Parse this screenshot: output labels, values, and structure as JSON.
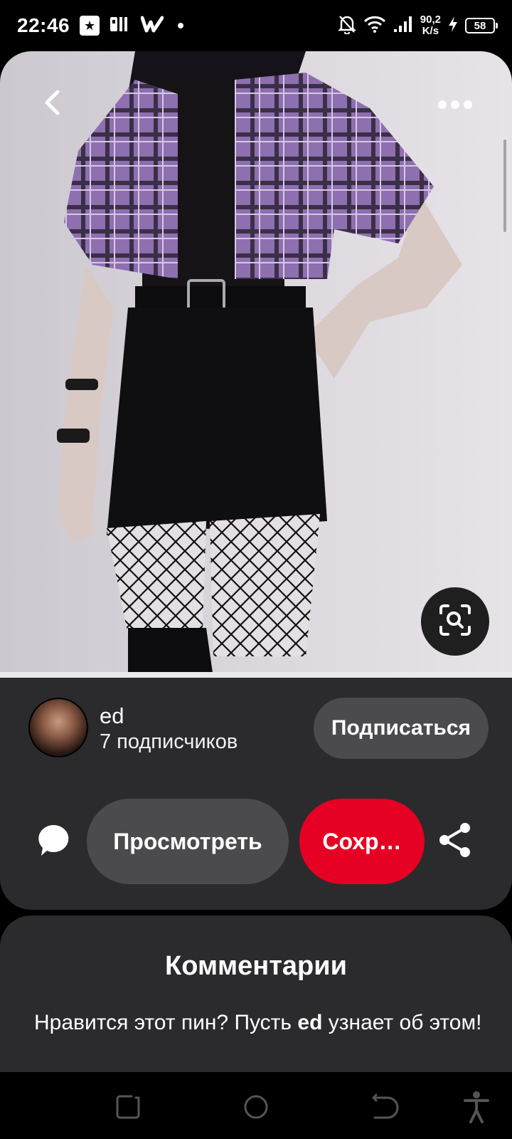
{
  "status_bar": {
    "time": "22:46",
    "app_icons": [
      "star-app-icon",
      "pi-app-icon",
      "wattpad-icon"
    ],
    "speed_value": "90,2",
    "speed_unit": "K/s",
    "battery": "58"
  },
  "pin": {
    "image_desc_icon": "outfit-photo",
    "back_icon": "chevron-left-icon",
    "more_icon": "more-horizontal-icon",
    "lens_icon": "visual-search-icon"
  },
  "creator": {
    "name": "ed",
    "followers": "7 подписчиков",
    "follow_label": "Подписаться"
  },
  "actions": {
    "view_label": "Просмотреть",
    "save_label": "Сохр…",
    "accent_color": "#e60023"
  },
  "comments": {
    "title": "Комментарии",
    "prompt_before": "Нравится этот пин? Пусть ",
    "prompt_name": "ed",
    "prompt_after": " узнает об этом!"
  }
}
